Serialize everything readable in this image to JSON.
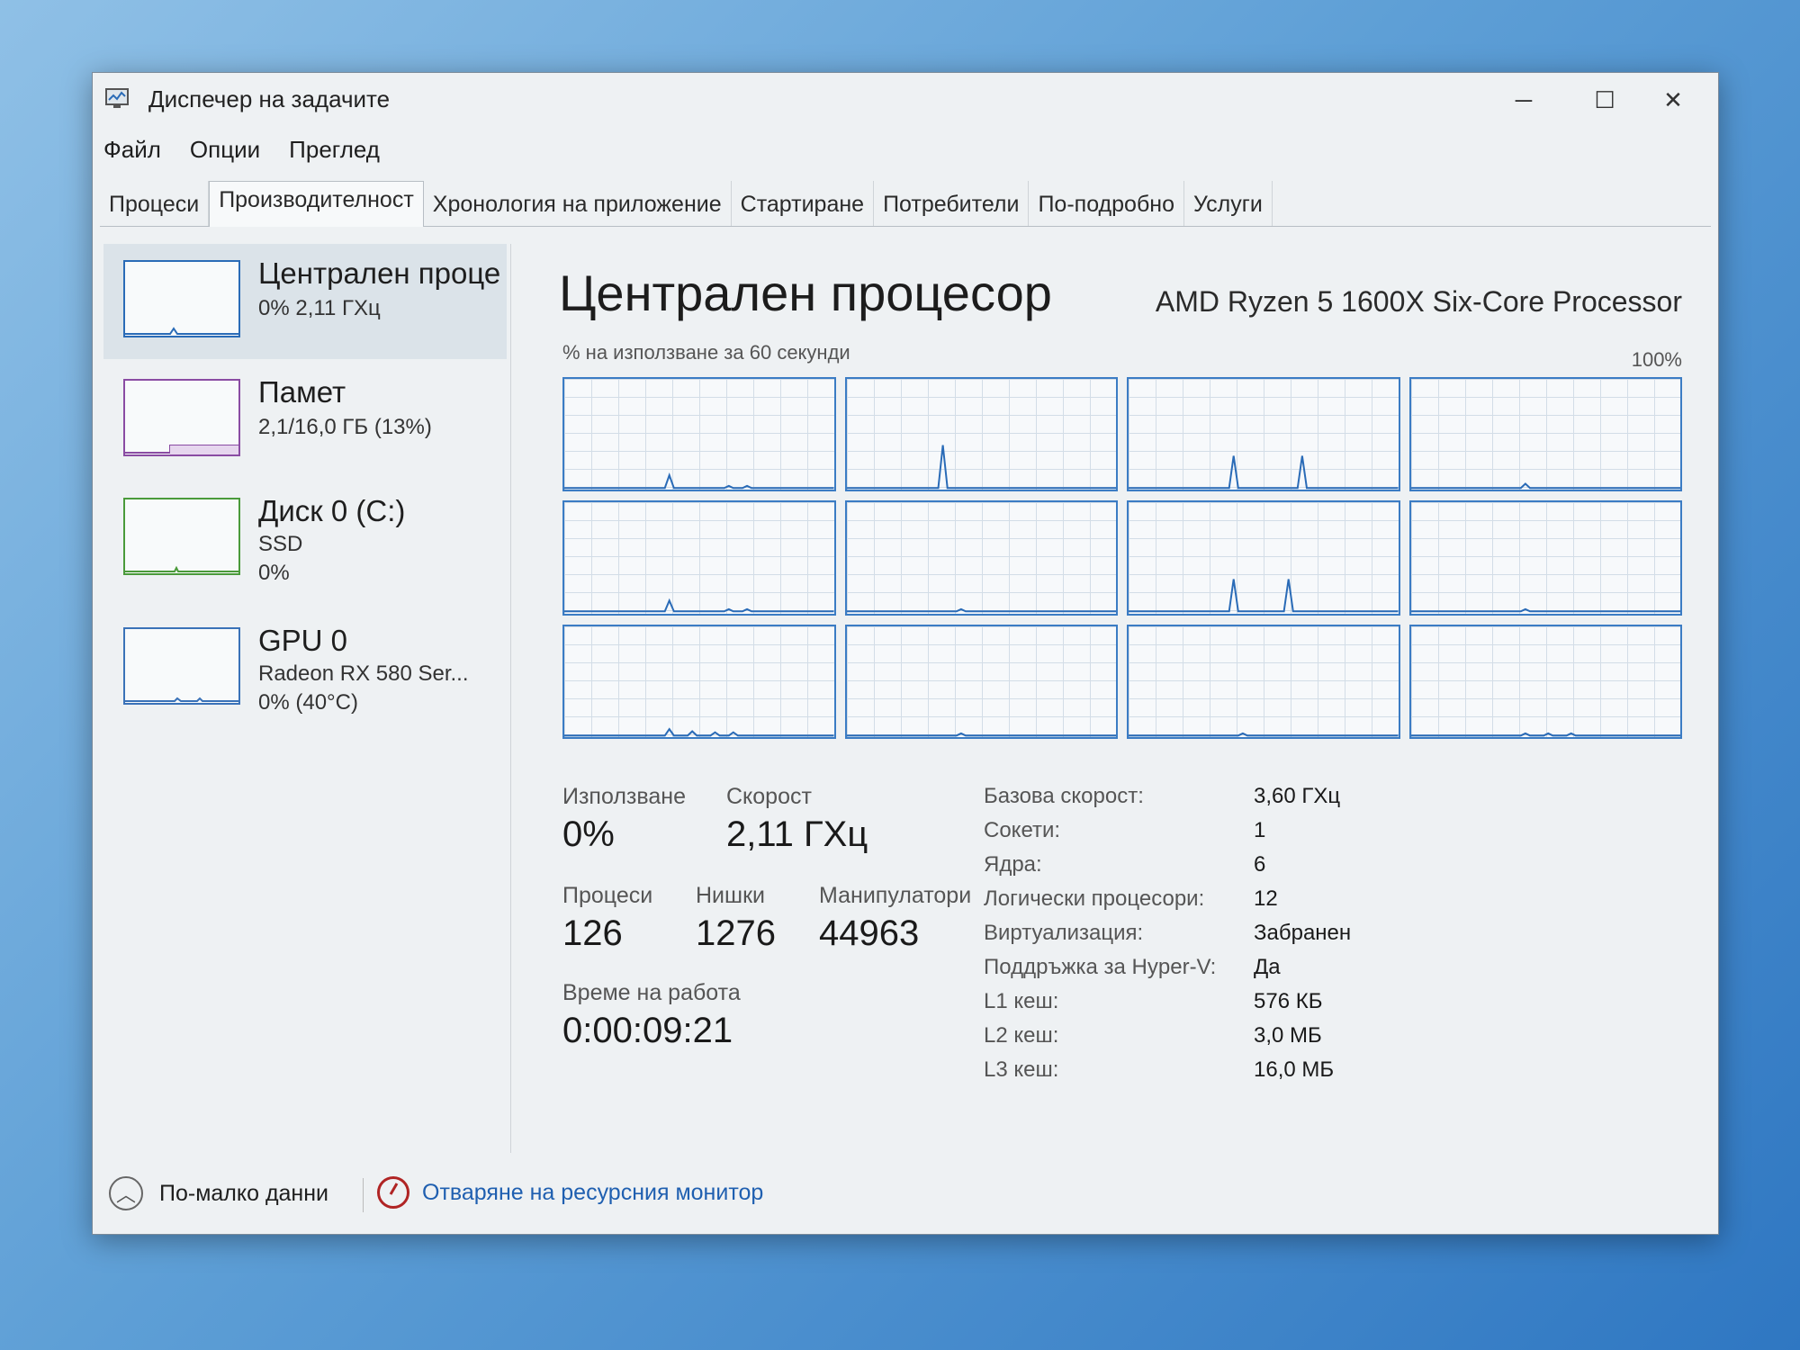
{
  "window": {
    "title": "Диспечер на задачите",
    "minimize": "─",
    "maximize": "☐",
    "close": "✕"
  },
  "menu": [
    "Файл",
    "Опции",
    "Преглед"
  ],
  "tabs": [
    "Процеси",
    "Производителност",
    "Хронология на приложение",
    "Стартиране",
    "Потребители",
    "По-подробно",
    "Услуги"
  ],
  "sidebar": {
    "cpu": {
      "title": "Централен проце",
      "sub1": "0% 2,11 ГХц"
    },
    "memory": {
      "title": "Памет",
      "sub1": "2,1/16,0 ГБ (13%)"
    },
    "disk": {
      "title": "Диск 0 (C:)",
      "sub1": "SSD",
      "sub2": "0%"
    },
    "gpu": {
      "title": "GPU 0",
      "sub1": "Radeon RX 580 Ser...",
      "sub2": "0% (40°C)"
    }
  },
  "main": {
    "title": "Централен процесор",
    "model": "AMD Ryzen 5 1600X Six-Core Processor",
    "graph_caption": "% на използване за 60 секунди",
    "graph_max": "100%"
  },
  "stats": {
    "usage_label": "Използване",
    "usage_value": "0%",
    "speed_label": "Скорост",
    "speed_value": "2,11 ГХц",
    "processes_label": "Процеси",
    "processes_value": "126",
    "threads_label": "Нишки",
    "threads_value": "1276",
    "handles_label": "Манипулатори",
    "handles_value": "44963",
    "uptime_label": "Време на работа",
    "uptime_value": "0:00:09:21"
  },
  "info": [
    {
      "key": "Базова скорост:",
      "value": "3,60 ГХц"
    },
    {
      "key": "Сокети:",
      "value": "1"
    },
    {
      "key": "Ядра:",
      "value": "6"
    },
    {
      "key": "Логически процесори:",
      "value": "12"
    },
    {
      "key": "Виртуализация:",
      "value": "Забранен"
    },
    {
      "key": "Поддръжка за Hyper-V:",
      "value": "Да"
    },
    {
      "key": "L1 кеш:",
      "value": "576 КБ"
    },
    {
      "key": "L2 кеш:",
      "value": "3,0 МБ"
    },
    {
      "key": "L3 кеш:",
      "value": "16,0 МБ"
    }
  ],
  "footer": {
    "fewer_details": "По-малко данни",
    "open_resmon": "Отваряне на ресурсния монитор"
  },
  "icons": {
    "app": "task-manager-icon",
    "fewer": "chevron-up-icon",
    "resmon": "resource-monitor-icon"
  },
  "colors": {
    "cpu": "#2a6bb7",
    "memory": "#8a4ca3",
    "disk": "#4a9a3a",
    "link": "#1f5fb0"
  },
  "core_usage": [
    [
      0,
      0,
      0,
      0,
      0,
      0,
      0,
      0,
      0,
      0,
      0,
      0,
      0,
      0,
      0,
      0,
      0,
      0,
      0,
      0,
      0,
      0,
      0,
      0,
      0,
      0,
      0,
      0,
      0,
      0,
      0,
      0,
      0,
      0,
      0,
      0,
      0,
      0,
      0,
      0,
      0,
      0,
      0,
      0,
      0,
      0,
      0,
      0,
      0,
      0,
      0,
      0,
      0,
      0,
      0,
      0,
      0,
      0,
      0,
      0
    ],
    [
      0,
      0,
      0,
      0,
      0,
      0,
      0,
      0,
      0,
      0,
      0,
      0,
      0,
      0,
      0,
      0,
      0,
      0,
      0,
      0,
      0,
      0,
      0,
      0,
      0,
      0,
      0,
      0,
      0,
      0,
      0,
      0,
      0,
      0,
      0,
      0,
      0,
      0,
      0,
      0,
      0,
      0,
      0,
      0,
      0,
      0,
      0,
      0,
      0,
      0,
      0,
      0,
      0,
      0,
      0,
      0,
      0,
      0,
      0,
      0
    ],
    [
      0,
      0,
      0,
      0,
      0,
      0,
      0,
      0,
      0,
      0,
      0,
      0,
      0,
      0,
      0,
      0,
      0,
      0,
      0,
      0,
      0,
      0,
      0,
      0,
      0,
      0,
      0,
      0,
      0,
      0,
      0,
      0,
      0,
      0,
      0,
      0,
      0,
      0,
      0,
      0,
      0,
      0,
      0,
      0,
      0,
      0,
      0,
      0,
      0,
      0,
      0,
      0,
      0,
      0,
      0,
      0,
      0,
      0,
      0,
      0
    ],
    [
      0,
      0,
      0,
      0,
      0,
      0,
      0,
      0,
      0,
      0,
      0,
      0,
      0,
      0,
      0,
      0,
      0,
      0,
      0,
      0,
      0,
      0,
      0,
      0,
      0,
      0,
      0,
      0,
      0,
      0,
      0,
      0,
      0,
      0,
      0,
      0,
      0,
      0,
      0,
      0,
      0,
      0,
      0,
      0,
      0,
      0,
      0,
      0,
      0,
      0,
      0,
      0,
      0,
      0,
      0,
      0,
      0,
      0,
      0,
      0
    ],
    [
      0,
      0,
      0,
      0,
      0,
      0,
      0,
      0,
      0,
      0,
      0,
      0,
      0,
      0,
      0,
      0,
      0,
      0,
      0,
      0,
      0,
      0,
      0,
      0,
      0,
      0,
      0,
      0,
      0,
      0,
      0,
      0,
      0,
      0,
      0,
      0,
      0,
      0,
      0,
      0,
      0,
      0,
      0,
      0,
      0,
      0,
      0,
      0,
      0,
      0,
      0,
      0,
      0,
      0,
      0,
      0,
      0,
      0,
      0,
      0
    ],
    [
      0,
      0,
      0,
      0,
      0,
      0,
      0,
      0,
      0,
      0,
      0,
      0,
      0,
      0,
      0,
      0,
      0,
      0,
      0,
      0,
      0,
      0,
      0,
      0,
      0,
      0,
      0,
      0,
      0,
      0,
      0,
      0,
      0,
      0,
      0,
      0,
      0,
      0,
      0,
      0,
      0,
      0,
      0,
      0,
      0,
      0,
      0,
      0,
      0,
      0,
      0,
      0,
      0,
      0,
      0,
      0,
      0,
      0,
      0,
      0
    ],
    [
      0,
      0,
      0,
      0,
      0,
      0,
      0,
      0,
      0,
      0,
      0,
      0,
      0,
      0,
      0,
      0,
      0,
      0,
      0,
      0,
      0,
      0,
      0,
      0,
      0,
      0,
      0,
      0,
      0,
      0,
      0,
      0,
      0,
      0,
      0,
      0,
      0,
      0,
      0,
      0,
      0,
      0,
      0,
      0,
      0,
      0,
      0,
      0,
      0,
      0,
      0,
      0,
      0,
      0,
      0,
      0,
      0,
      0,
      0,
      0
    ],
    [
      0,
      0,
      0,
      0,
      0,
      0,
      0,
      0,
      0,
      0,
      0,
      0,
      0,
      0,
      0,
      0,
      0,
      0,
      0,
      0,
      0,
      0,
      0,
      0,
      0,
      0,
      0,
      0,
      0,
      0,
      0,
      0,
      0,
      0,
      0,
      0,
      0,
      0,
      0,
      0,
      0,
      0,
      0,
      0,
      0,
      0,
      0,
      0,
      0,
      0,
      0,
      0,
      0,
      0,
      0,
      0,
      0,
      0,
      0,
      0
    ],
    [
      0,
      0,
      0,
      0,
      0,
      0,
      0,
      0,
      0,
      0,
      0,
      0,
      0,
      0,
      0,
      0,
      0,
      0,
      0,
      0,
      0,
      0,
      0,
      0,
      0,
      0,
      0,
      0,
      0,
      0,
      0,
      0,
      0,
      0,
      0,
      0,
      0,
      0,
      0,
      0,
      0,
      0,
      0,
      0,
      0,
      0,
      0,
      0,
      0,
      0,
      0,
      0,
      0,
      0,
      0,
      0,
      0,
      0,
      0,
      0
    ],
    [
      0,
      0,
      0,
      0,
      0,
      0,
      0,
      0,
      0,
      0,
      0,
      0,
      0,
      0,
      0,
      0,
      0,
      0,
      0,
      0,
      0,
      0,
      0,
      0,
      0,
      0,
      0,
      0,
      0,
      0,
      0,
      0,
      0,
      0,
      0,
      0,
      0,
      0,
      0,
      0,
      0,
      0,
      0,
      0,
      0,
      0,
      0,
      0,
      0,
      0,
      0,
      0,
      0,
      0,
      0,
      0,
      0,
      0,
      0,
      0
    ],
    [
      0,
      0,
      0,
      0,
      0,
      0,
      0,
      0,
      0,
      0,
      0,
      0,
      0,
      0,
      0,
      0,
      0,
      0,
      0,
      0,
      0,
      0,
      0,
      0,
      0,
      0,
      0,
      0,
      0,
      0,
      0,
      0,
      0,
      0,
      0,
      0,
      0,
      0,
      0,
      0,
      0,
      0,
      0,
      0,
      0,
      0,
      0,
      0,
      0,
      0,
      0,
      0,
      0,
      0,
      0,
      0,
      0,
      0,
      0,
      0
    ],
    [
      0,
      0,
      0,
      0,
      0,
      0,
      0,
      0,
      0,
      0,
      0,
      0,
      0,
      0,
      0,
      0,
      0,
      0,
      0,
      0,
      0,
      0,
      0,
      0,
      0,
      0,
      0,
      0,
      0,
      0,
      0,
      0,
      0,
      0,
      0,
      0,
      0,
      0,
      0,
      0,
      0,
      0,
      0,
      0,
      0,
      0,
      0,
      0,
      0,
      0,
      0,
      0,
      0,
      0,
      0,
      0,
      0,
      0,
      0,
      0
    ]
  ],
  "core_spikes": [
    [
      [
        23,
        12
      ],
      [
        36,
        2
      ],
      [
        40,
        2
      ]
    ],
    [
      [
        21,
        40
      ]
    ],
    [
      [
        23,
        30
      ],
      [
        38,
        30
      ]
    ],
    [
      [
        25,
        4
      ]
    ],
    [
      [
        23,
        10
      ],
      [
        36,
        2
      ],
      [
        40,
        2
      ]
    ],
    [
      [
        25,
        2
      ]
    ],
    [
      [
        23,
        30
      ],
      [
        35,
        30
      ]
    ],
    [
      [
        25,
        2
      ]
    ],
    [
      [
        23,
        6
      ],
      [
        28,
        4
      ],
      [
        33,
        3
      ],
      [
        37,
        3
      ]
    ],
    [
      [
        25,
        2
      ]
    ],
    [
      [
        25,
        2
      ]
    ],
    [
      [
        25,
        2
      ],
      [
        30,
        2
      ],
      [
        35,
        2
      ]
    ]
  ]
}
